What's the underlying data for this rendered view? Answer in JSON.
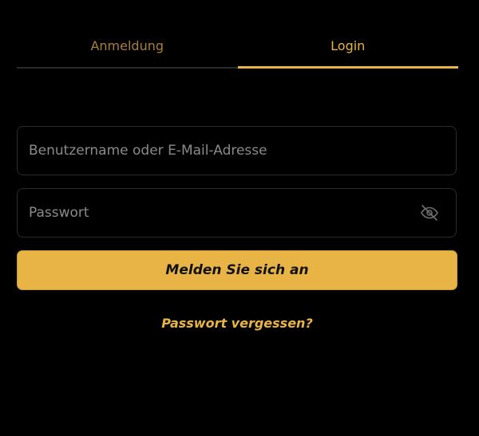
{
  "tabs": [
    {
      "label": "Anmeldung",
      "active": false
    },
    {
      "label": "Login",
      "active": true
    }
  ],
  "form": {
    "username": {
      "value": "",
      "placeholder": "Benutzername oder E-Mail-Adresse"
    },
    "password": {
      "value": "",
      "placeholder": "Passwort",
      "toggle_icon": "eye-off-icon"
    },
    "submit_label": "Melden Sie sich an",
    "forgot_label": "Passwort vergessen?"
  },
  "colors": {
    "background": "#000000",
    "accent": "#e9b447",
    "tab_inactive": "#a87f3c",
    "field_border": "#2b2b2b",
    "placeholder": "#8a8a8a",
    "button_text": "#111111"
  }
}
